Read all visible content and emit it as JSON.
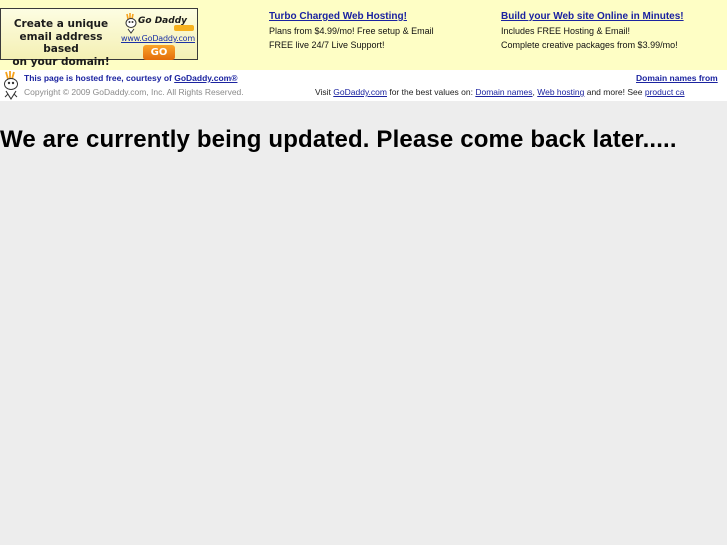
{
  "ad_banner": {
    "text_line1": "Create a unique",
    "text_line2": "email address based",
    "text_line3": "on your domain!",
    "logo_text": "Go Daddy",
    "url": "www.GoDaddy.com",
    "go_label": "GO"
  },
  "promos": [
    {
      "title": "Turbo Charged Web Hosting!",
      "line1": "Plans from $4.99/mo! Free setup & Email",
      "line2": "FREE live 24/7 Live Support!"
    },
    {
      "title": "Build your Web site Online in Minutes!",
      "line1": "Includes FREE Hosting & Email!",
      "line2": "Complete creative packages from $3.99/mo!"
    }
  ],
  "host": {
    "hosted_text": "This page is hosted free, courtesy of ",
    "hosted_link": "GoDaddy.com®",
    "copyright": "Copyright © 2009 GoDaddy.com, Inc. All Rights Reserved.",
    "domain_link": "Domain names from",
    "visit_prefix": "Visit ",
    "visit_link": "GoDaddy.com",
    "visit_mid": " for the best values on: ",
    "link_domain_names": "Domain names",
    "sep": ", ",
    "link_web_hosting": "Web hosting",
    "visit_suffix": " and more! See ",
    "link_product_catalog": "product ca"
  },
  "main": {
    "message": "We are currently being updated. Please come back later....."
  },
  "colors": {
    "top_bg": "#fefec5",
    "link_blue": "#1b23a0",
    "page_bg": "#ededed",
    "go_orange": "#e36c0a"
  },
  "icons": {
    "mascot": "godaddy-mascot-icon"
  }
}
